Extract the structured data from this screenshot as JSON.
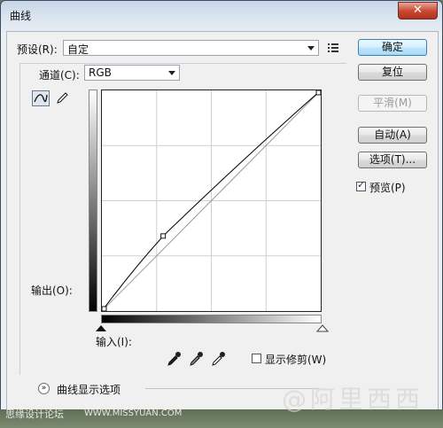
{
  "window": {
    "title": "曲线",
    "close_glyph": "✕"
  },
  "preset": {
    "label": "预设(R):",
    "value": "自定",
    "menu_icon": "preset-menu-icon"
  },
  "channel": {
    "label": "通道(C):",
    "value": "RGB"
  },
  "tools": {
    "curve_tool_icon": "curve-tool-icon",
    "pencil_tool_icon": "pencil-tool-icon"
  },
  "buttons": {
    "ok": "确定",
    "reset": "复位",
    "smooth": "平滑(M)",
    "auto": "自动(A)",
    "options": "选项(T)..."
  },
  "preview": {
    "label": "预览(P)",
    "checked": true
  },
  "output_label": "输出(O):",
  "input_label": "输入(I):",
  "eyedroppers": [
    "black-eyedropper-icon",
    "gray-eyedropper-icon",
    "white-eyedropper-icon"
  ],
  "show_clipping": {
    "label": "显示修剪(W)",
    "checked": false
  },
  "curve_display_options": "曲线显示选项",
  "curve": {
    "points": [
      [
        0,
        0
      ],
      [
        0.28,
        0.34
      ],
      [
        1,
        1
      ]
    ]
  },
  "watermark": {
    "site_cn": "思缘设计论坛",
    "site_url": "WWW.MISSYUAN.COM",
    "logo_text": "@阿里西西"
  }
}
